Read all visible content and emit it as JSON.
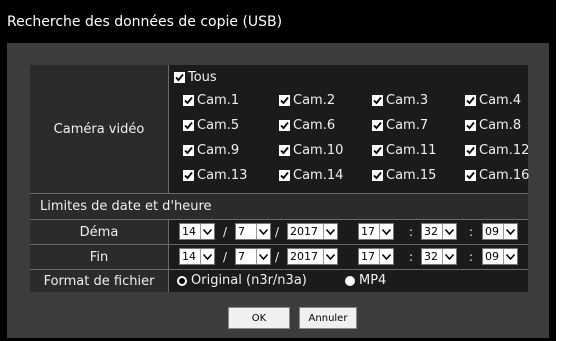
{
  "window": {
    "title": "Recherche des données de copie (USB)"
  },
  "camera": {
    "label": "Caméra vidéo",
    "all": {
      "label": "Tous",
      "checked": true
    },
    "items": [
      {
        "label": "Cam.1",
        "checked": true
      },
      {
        "label": "Cam.2",
        "checked": true
      },
      {
        "label": "Cam.3",
        "checked": true
      },
      {
        "label": "Cam.4",
        "checked": true
      },
      {
        "label": "Cam.5",
        "checked": true
      },
      {
        "label": "Cam.6",
        "checked": true
      },
      {
        "label": "Cam.7",
        "checked": true
      },
      {
        "label": "Cam.8",
        "checked": true
      },
      {
        "label": "Cam.9",
        "checked": true
      },
      {
        "label": "Cam.10",
        "checked": true
      },
      {
        "label": "Cam.11",
        "checked": true
      },
      {
        "label": "Cam.12",
        "checked": true
      },
      {
        "label": "Cam.13",
        "checked": true
      },
      {
        "label": "Cam.14",
        "checked": true
      },
      {
        "label": "Cam.15",
        "checked": true
      },
      {
        "label": "Cam.16",
        "checked": true
      }
    ]
  },
  "limits": {
    "label": "Limites de date et d'heure"
  },
  "start": {
    "label": "Déma",
    "day": "14",
    "month": "7",
    "year": "2017",
    "hour": "17",
    "minute": "32",
    "second": "09"
  },
  "end": {
    "label": "Fin",
    "day": "14",
    "month": "7",
    "year": "2017",
    "hour": "17",
    "minute": "32",
    "second": "09"
  },
  "separators": {
    "date": "/",
    "time": ":"
  },
  "format": {
    "label": "Format de fichier",
    "options": [
      {
        "label": "Original (n3r/n3a)",
        "selected": true
      },
      {
        "label": "MP4",
        "selected": false
      }
    ]
  },
  "buttons": {
    "ok": "OK",
    "cancel": "Annuler"
  }
}
